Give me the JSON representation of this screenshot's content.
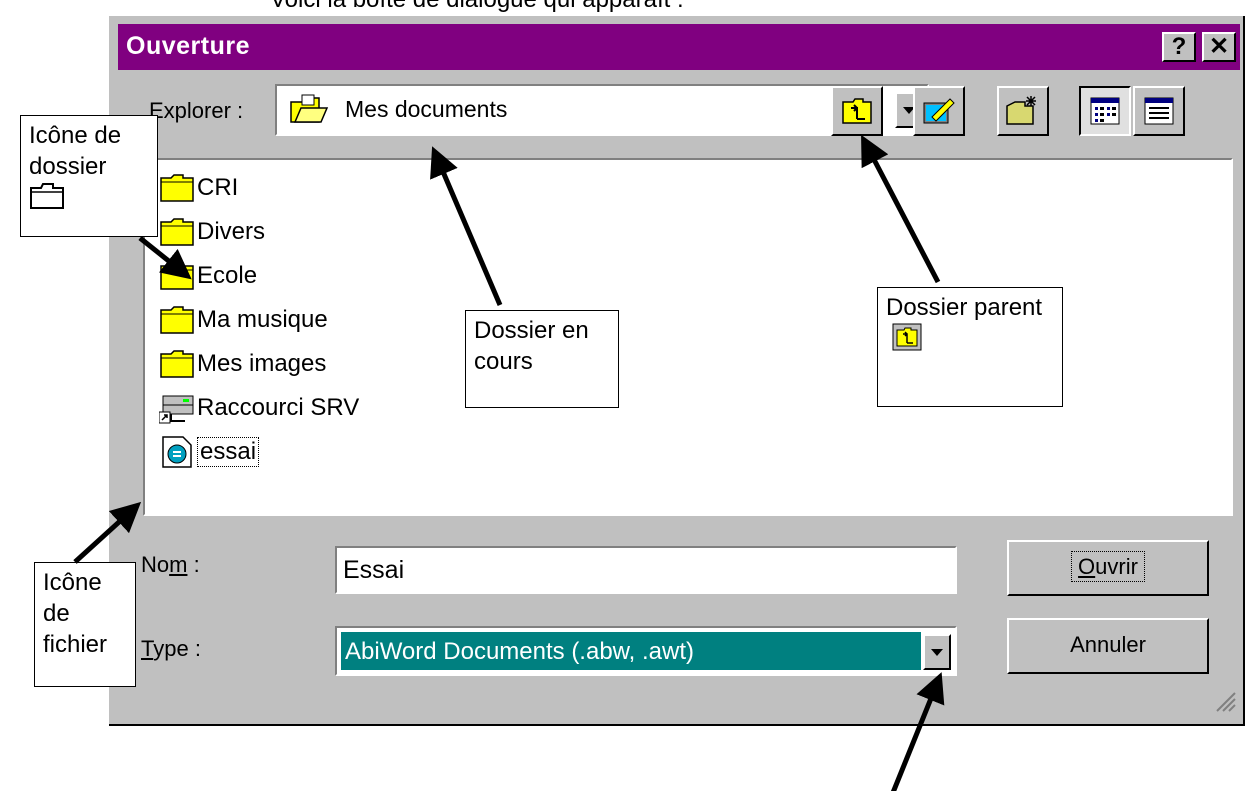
{
  "top_caption": "Voici la boîte de dialogue qui apparaît :",
  "dialog": {
    "title": "Ouverture",
    "help_button": "?",
    "close_button": "✕",
    "explore_label": "Explorer :",
    "current_folder": "Mes documents",
    "files": [
      {
        "name": "CRI",
        "icon": "folder-icon"
      },
      {
        "name": "Divers",
        "icon": "folder-icon"
      },
      {
        "name": "Ecole",
        "icon": "folder-icon"
      },
      {
        "name": "Ma musique",
        "icon": "folder-icon"
      },
      {
        "name": "Mes images",
        "icon": "folder-icon"
      },
      {
        "name": "Raccourci SRV",
        "icon": "network-shortcut-icon"
      },
      {
        "name": "essai",
        "icon": "abiword-file-icon"
      }
    ],
    "name_label": "Nom :",
    "name_value": "Essai",
    "type_label": "Type :",
    "type_value": "AbiWord Documents (.abw, .awt)",
    "open_button": "Ouvrir",
    "cancel_button": "Annuler"
  },
  "callouts": {
    "folder_icon": "Icône de dossier",
    "current_folder": "Dossier en cours",
    "parent_folder": "Dossier parent",
    "file_icon": "Icône de fichier"
  },
  "colors": {
    "titlebar": "#800080",
    "dialog_bg": "#c0c0c0",
    "selection": "#008080",
    "folder": "#ffff00"
  }
}
